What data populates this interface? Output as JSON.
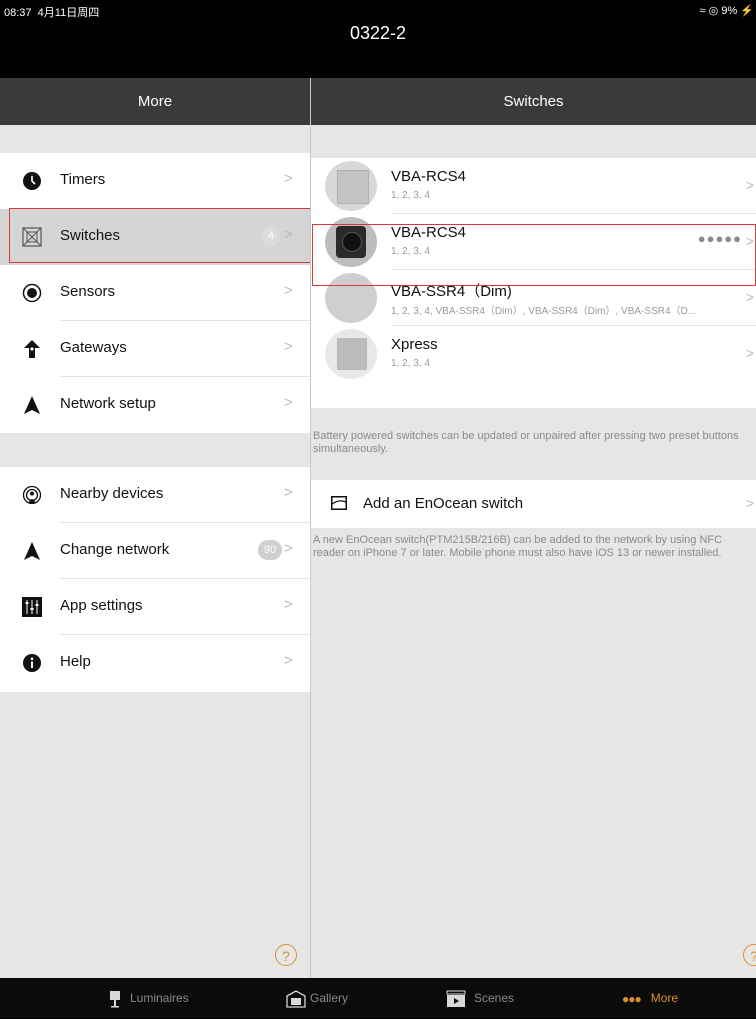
{
  "status_bar": {
    "time": "08:37",
    "date": "4月11日周四",
    "battery": "9%"
  },
  "app_title": "0322-2",
  "more_panel": {
    "title": "More",
    "groups": [
      [
        {
          "label": "Timers",
          "icon": "clock-icon"
        },
        {
          "label": "Switches",
          "icon": "switch-icon",
          "badge": "4",
          "selected": true
        },
        {
          "label": "Sensors",
          "icon": "sensor-icon"
        },
        {
          "label": "Gateways",
          "icon": "gateway-icon"
        },
        {
          "label": "Network setup",
          "icon": "network-icon"
        }
      ],
      [
        {
          "label": "Nearby devices",
          "icon": "nearby-icon"
        },
        {
          "label": "Change network",
          "icon": "change-network-icon",
          "badge": "90"
        },
        {
          "label": "App settings",
          "icon": "settings-icon"
        },
        {
          "label": "Help",
          "icon": "info-icon"
        }
      ]
    ],
    "help_button": "?"
  },
  "switches_panel": {
    "title": "Switches",
    "items": [
      {
        "name": "VBA-RCS4",
        "buttons": "1, 2, 3, 4"
      },
      {
        "name": "VBA-RCS4",
        "buttons": "1, 2, 3, 4",
        "dots": "●●●●●",
        "selected": true
      },
      {
        "name": "VBA-SSR4（Dim)",
        "buttons": "1, 2, 3, 4, VBA-SSR4（Dim）, VBA-SSR4（Dim）, VBA-SSR4（D..."
      },
      {
        "name": "Xpress",
        "buttons": "1, 2, 3, 4"
      }
    ],
    "battery_note": "Battery powered switches can be updated or unpaired after pressing two preset buttons simultaneously.",
    "add_switch_label": "Add an EnOcean switch",
    "add_note": "A new EnOcean switch(PTM215B/216B) can be added to the network by using NFC reader on iPhone 7 or later. Mobile phone must also have iOS 13 or newer installed.",
    "help_button": "?"
  },
  "tab_bar": {
    "tabs": [
      {
        "label": "Luminaires",
        "icon": "lamp-icon"
      },
      {
        "label": "Gallery",
        "icon": "gallery-icon"
      },
      {
        "label": "Scenes",
        "icon": "scenes-icon"
      },
      {
        "label": "More",
        "icon": "more-dots-icon",
        "active": true
      }
    ]
  },
  "colors": {
    "accent": "#d9902a",
    "highlight_border": "#d3393e",
    "header_bg": "#3a3a3a"
  }
}
